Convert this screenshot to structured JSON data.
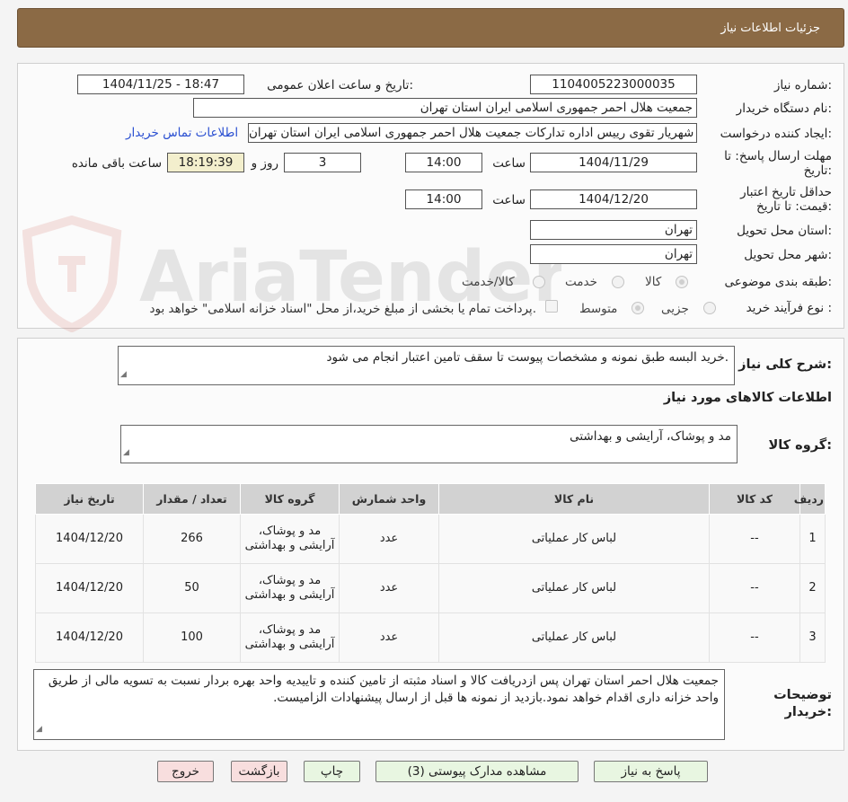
{
  "header": {
    "title": "جزئیات اطلاعات نیاز"
  },
  "watermark": {
    "text": "AriaTender.neT"
  },
  "form": {
    "need_number_label": "شماره نیاز:",
    "need_number": "1104005223000035",
    "announce_label": "تاریخ و ساعت اعلان عمومی:",
    "announce_value": "1404/11/25 - 18:47",
    "buyer_org_label": "نام دستگاه خریدار:",
    "buyer_org": "جمعیت هلال احمر جمهوری اسلامی ایران استان تهران",
    "requester_label": "ایجاد کننده درخواست:",
    "requester": "شهریار تقوی رییس اداره تداركات جمعیت هلال احمر جمهوری اسلامی ایران استان تهران",
    "contact_link": "اطلاعات تماس خریدار",
    "deadline_label": "مهلت ارسال پاسخ: تا تاریخ:",
    "deadline_date": "1404/11/29",
    "time_label": "ساعت",
    "deadline_time": "14:00",
    "days_value": "3",
    "days_label": "روز و",
    "remaining_time": "18:19:39",
    "remaining_label": "ساعت باقی مانده",
    "validity_label": "حداقل تاریخ اعتبار قیمت: تا تاریخ:",
    "validity_date": "1404/12/20",
    "validity_time": "14:00",
    "province_label": "استان محل تحویل:",
    "province": "تهران",
    "city_label": "شهر محل تحویل:",
    "city": "تهران",
    "category_label": "طبقه بندی موضوعی:",
    "category_options": [
      "کالا",
      "خدمت",
      "کالا/خدمت"
    ],
    "category_selected": "کالا",
    "process_label": "نوع فرآیند خرید :",
    "process_options": [
      "جزیی",
      "متوسط"
    ],
    "process_selected": "متوسط",
    "payment_note": "پرداخت تمام یا بخشی از مبلغ خرید،از محل \"اسناد خزانه اسلامی\" خواهد بود."
  },
  "summary": {
    "label": "شرح کلی نیاز:",
    "text": "خرید البسه طبق نمونه و مشخصات پیوست تا سقف تامین اعتبار انجام می شود.",
    "goods_info_title": "اطلاعات کالاهای مورد نیاز",
    "goods_group_label": "گروه کالا:",
    "goods_group": "مد و پوشاک، آرایشی و بهداشتی"
  },
  "table": {
    "headers": [
      "ردیف",
      "کد کالا",
      "نام کالا",
      "واحد شمارش",
      "گروه کالا",
      "تعداد / مقدار",
      "تاریخ نیاز"
    ],
    "rows": [
      [
        "1",
        "--",
        "لباس کار عملیاتی",
        "عدد",
        "مد و پوشاک، آرایشی و بهداشتی",
        "266",
        "1404/12/20"
      ],
      [
        "2",
        "--",
        "لباس کار عملیاتی",
        "عدد",
        "مد و پوشاک، آرایشی و بهداشتی",
        "50",
        "1404/12/20"
      ],
      [
        "3",
        "--",
        "لباس کار عملیاتی",
        "عدد",
        "مد و پوشاک، آرایشی و بهداشتی",
        "100",
        "1404/12/20"
      ]
    ]
  },
  "notes": {
    "label": "توضیحات خریدار:",
    "text": "جمعیت هلال احمر استان تهران پس ازدریافت کالا و اسناد مثبته از تامین کننده و تاییدیه واحد بهره بردار نسبت به تسویه مالی از طریق واحد خزانه داری اقدام خواهد نمود.بازدید از نمونه ها قبل از ارسال پیشنهادات الزامیست."
  },
  "buttons": {
    "reply": "پاسخ به نیاز",
    "attachments": "مشاهده مدارک پیوستی (3)",
    "print": "چاپ",
    "back": "بازگشت",
    "exit": "خروج"
  }
}
